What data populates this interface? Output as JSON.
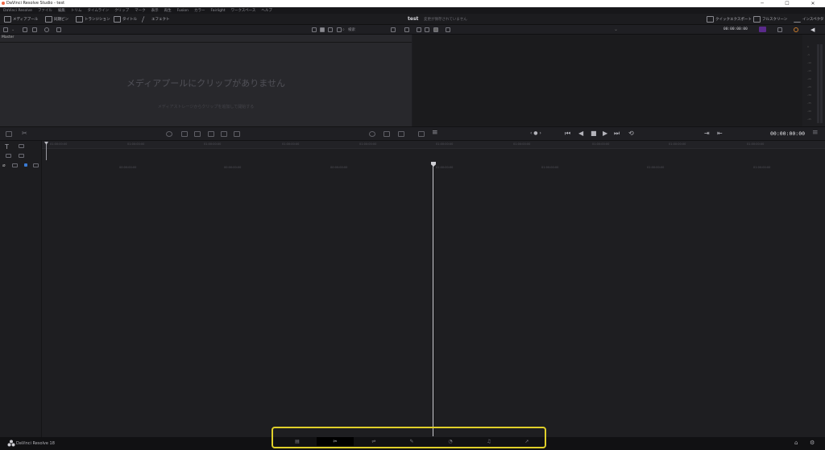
{
  "window": {
    "title": "DaVinci Resolve Studio - test",
    "minimize": "─",
    "maximize": "☐",
    "close": "✕"
  },
  "menu": [
    "DaVinci Resolve",
    "ファイル",
    "編集",
    "トリム",
    "タイムライン",
    "クリップ",
    "マーク",
    "表示",
    "再生",
    "Fusion",
    "カラー",
    "Fairlight",
    "ワークスペース",
    "ヘルプ"
  ],
  "toolbar": {
    "media_pool": "メディアプール",
    "sync_bin": "同期ビン",
    "transitions": "トランジション",
    "titles": "タイトル",
    "effects": "エフェクト",
    "project_title": "test",
    "project_status": "変更が保存されていません",
    "quick_export": "クイックエクスポート",
    "full_screen": "フルスクリーン",
    "inspector": "インスペクタ"
  },
  "subbar": {
    "search_label": "検索",
    "viewer_timecode": "00:00:00:00"
  },
  "media_pool": {
    "bin": "Master",
    "empty_message": "メディアプールにクリップがありません",
    "hint": "メディアストレージからクリップを追加して開始する"
  },
  "meters": {
    "scale": [
      "0",
      "-5",
      "-10",
      "-15",
      "-20",
      "-25",
      "-30",
      "-35",
      "-40",
      "-45",
      "-50"
    ]
  },
  "transport": {
    "timecode": "00:00:00:00",
    "nav": "‹ ● ›",
    "buttons": [
      "⏮",
      "◀",
      "■",
      "▶",
      "⏭",
      "⟲"
    ],
    "right": [
      "⇥",
      "⇤"
    ]
  },
  "timeline": {
    "ruler_top": [
      "01:00:00:00",
      "01:00:00:00",
      "01:00:00:00",
      "01:00:00:00",
      "01:00:00:00",
      "01:00:00:00",
      "01:00:00:00",
      "01:00:00:00",
      "01:00:00:00",
      "01:00:00:00"
    ],
    "ruler_main": [
      "00:00:00:00",
      "00:00:00:00",
      "00:00:00:00",
      "01:00:00:00",
      "01:00:00:00",
      "01:00:00:00",
      "01:00:00:00"
    ]
  },
  "bottom": {
    "app_name": "DaVinci Resolve 18",
    "pages": [
      {
        "name": "media-page",
        "glyph": "▤"
      },
      {
        "name": "cut-page",
        "glyph": "✂"
      },
      {
        "name": "edit-page",
        "glyph": "⇌"
      },
      {
        "name": "fusion-page",
        "glyph": "✎"
      },
      {
        "name": "color-page",
        "glyph": "◔"
      },
      {
        "name": "fairlight-page",
        "glyph": "♫"
      },
      {
        "name": "deliver-page",
        "glyph": "➚"
      }
    ],
    "home": "⌂",
    "settings": "⚙"
  },
  "colors": {
    "highlight": "#e0d02a",
    "accent": "#3a7bd5"
  }
}
